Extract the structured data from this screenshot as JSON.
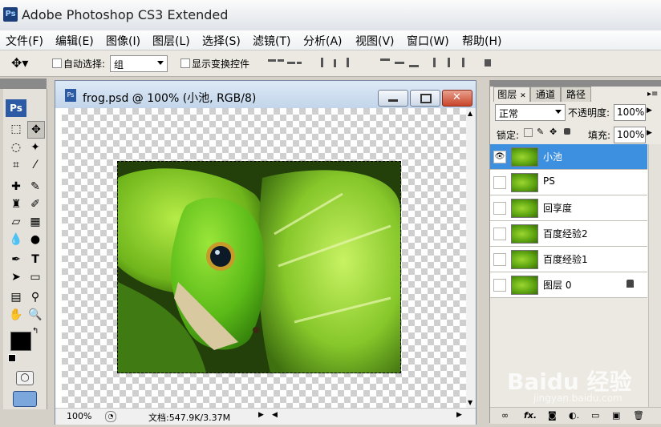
{
  "app": {
    "title": "Adobe Photoshop CS3 Extended",
    "logo": "Ps"
  },
  "menu": [
    "文件(F)",
    "编辑(E)",
    "图像(I)",
    "图层(L)",
    "选择(S)",
    "滤镜(T)",
    "分析(A)",
    "视图(V)",
    "窗口(W)",
    "帮助(H)"
  ],
  "options": {
    "auto_select_label": "自动选择:",
    "auto_select_value": "组",
    "show_transform_label": "显示变换控件"
  },
  "toolbox": {
    "logo": "Ps"
  },
  "document": {
    "title": "frog.psd @ 100% (小池, RGB/8)",
    "zoom": "100%",
    "doc_info": "文档:547.9K/3.37M"
  },
  "panel": {
    "tabs": [
      "图层",
      "通道",
      "路径"
    ],
    "blend_mode": "正常",
    "opacity_label": "不透明度:",
    "opacity_value": "100%",
    "lock_label": "锁定:",
    "fill_label": "填充:",
    "fill_value": "100%",
    "layers": [
      {
        "name": "小池",
        "visible": true,
        "selected": true,
        "locked": false
      },
      {
        "name": "PS",
        "visible": false,
        "selected": false,
        "locked": false
      },
      {
        "name": "回享度",
        "visible": false,
        "selected": false,
        "locked": false
      },
      {
        "name": "百度经验2",
        "visible": false,
        "selected": false,
        "locked": false
      },
      {
        "name": "百度经验1",
        "visible": false,
        "selected": false,
        "locked": false
      },
      {
        "name": "图层 0",
        "visible": false,
        "selected": false,
        "locked": true
      }
    ]
  },
  "watermark": {
    "brand": "Baidu 经验",
    "url": "jingyan.baidu.com"
  },
  "colors": {
    "selected_layer": "#3d8fe0",
    "close_button": "#c7452a",
    "title_bar": "#dde9f6"
  }
}
